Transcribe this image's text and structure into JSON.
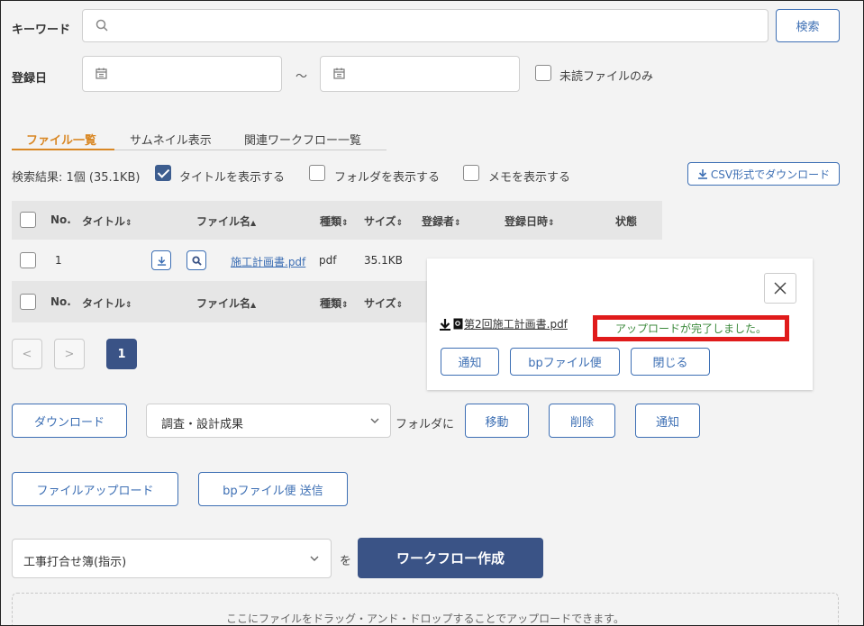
{
  "search": {
    "keyword_label": "キーワード",
    "keyword_value": "",
    "search_button": "検索",
    "date_label": "登録日",
    "date_separator": "～",
    "unread_only_label": "未読ファイルのみ"
  },
  "tabs": [
    {
      "label": "ファイル一覧",
      "active": true
    },
    {
      "label": "サムネイル表示",
      "active": false
    },
    {
      "label": "関連ワークフロー一覧",
      "active": false
    }
  ],
  "results": {
    "summary": "検索結果: 1個 (35.1KB)",
    "show_title_label": "タイトルを表示する",
    "show_folder_label": "フォルダを表示する",
    "show_memo_label": "メモを表示する",
    "csv_download_label": "CSV形式でダウンロード"
  },
  "table": {
    "headers": {
      "no": "No.",
      "title": "タイトル",
      "filename": "ファイル名",
      "type": "種類",
      "size": "サイズ",
      "registrant": "登録者",
      "registered_at": "登録日時",
      "status": "状態"
    },
    "row": {
      "no": "1",
      "filename": "施工計画書.pdf",
      "type": "pdf",
      "size": "35.1KB"
    }
  },
  "pagination": {
    "prev": "<",
    "next": ">",
    "current": "1"
  },
  "actions": {
    "download": "ダウンロード",
    "folder_select_value": "調査・設計成果",
    "folder_suffix": "フォルダに",
    "move": "移動",
    "delete": "削除",
    "notify": "通知",
    "file_upload": "ファイルアップロード",
    "bp_send": "bpファイル便 送信",
    "workflow_select_value": "工事打合せ簿(指示)",
    "workflow_suffix": "を",
    "workflow_create": "ワークフロー作成",
    "dropzone_text": "ここにファイルをドラッグ・アンド・ドロップすることでアップロードできます。"
  },
  "modal": {
    "uploaded_file": "第2回施工計画書.pdf",
    "message": "アップロードが完了しました。",
    "notify_button": "通知",
    "bp_button": "bpファイル便",
    "close_button": "閉じる"
  },
  "colors": {
    "accent_blue": "#3d6fb4",
    "tab_active": "#d98724",
    "dark_button": "#3a5386",
    "success_text": "#3c8a3c",
    "highlight_red": "#e01b1b"
  }
}
